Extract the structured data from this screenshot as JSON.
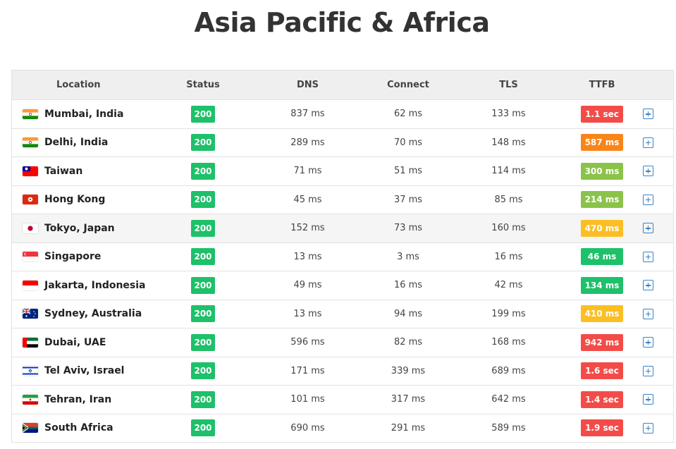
{
  "page": {
    "title": "Asia Pacific & Africa"
  },
  "table": {
    "headers": {
      "location": "Location",
      "status": "Status",
      "dns": "DNS",
      "connect": "Connect",
      "tls": "TLS",
      "ttfb": "TTFB"
    },
    "rows": [
      {
        "flag": "india-flag-icon",
        "location": "Mumbai, India",
        "status": "200",
        "dns": "837 ms",
        "connect": "62 ms",
        "tls": "133 ms",
        "ttfb": "1.1 sec",
        "ttfb_color": "#f34c48"
      },
      {
        "flag": "india-flag-icon",
        "location": "Delhi, India",
        "status": "200",
        "dns": "289 ms",
        "connect": "70 ms",
        "tls": "148 ms",
        "ttfb": "587 ms",
        "ttfb_color": "#f98519"
      },
      {
        "flag": "taiwan-flag-icon",
        "location": "Taiwan",
        "status": "200",
        "dns": "71 ms",
        "connect": "51 ms",
        "tls": "114 ms",
        "ttfb": "300 ms",
        "ttfb_color": "#8bc34a"
      },
      {
        "flag": "hong-kong-flag-icon",
        "location": "Hong Kong",
        "status": "200",
        "dns": "45 ms",
        "connect": "37 ms",
        "tls": "85 ms",
        "ttfb": "214 ms",
        "ttfb_color": "#8bc34a"
      },
      {
        "flag": "japan-flag-icon",
        "location": "Tokyo, Japan",
        "status": "200",
        "dns": "152 ms",
        "connect": "73 ms",
        "tls": "160 ms",
        "ttfb": "470 ms",
        "ttfb_color": "#fbbf24",
        "highlight": true
      },
      {
        "flag": "singapore-flag-icon",
        "location": "Singapore",
        "status": "200",
        "dns": "13 ms",
        "connect": "3 ms",
        "tls": "16 ms",
        "ttfb": "46 ms",
        "ttfb_color": "#1ec06a"
      },
      {
        "flag": "indonesia-flag-icon",
        "location": "Jakarta, Indonesia",
        "status": "200",
        "dns": "49 ms",
        "connect": "16 ms",
        "tls": "42 ms",
        "ttfb": "134 ms",
        "ttfb_color": "#1ec06a"
      },
      {
        "flag": "australia-flag-icon",
        "location": "Sydney, Australia",
        "status": "200",
        "dns": "13 ms",
        "connect": "94 ms",
        "tls": "199 ms",
        "ttfb": "410 ms",
        "ttfb_color": "#fbbf24"
      },
      {
        "flag": "uae-flag-icon",
        "location": "Dubai, UAE",
        "status": "200",
        "dns": "596 ms",
        "connect": "82 ms",
        "tls": "168 ms",
        "ttfb": "942 ms",
        "ttfb_color": "#f34c48"
      },
      {
        "flag": "israel-flag-icon",
        "location": "Tel Aviv, Israel",
        "status": "200",
        "dns": "171 ms",
        "connect": "339 ms",
        "tls": "689 ms",
        "ttfb": "1.6 sec",
        "ttfb_color": "#f34c48"
      },
      {
        "flag": "iran-flag-icon",
        "location": "Tehran, Iran",
        "status": "200",
        "dns": "101 ms",
        "connect": "317 ms",
        "tls": "642 ms",
        "ttfb": "1.4 sec",
        "ttfb_color": "#f34c48"
      },
      {
        "flag": "south-africa-flag-icon",
        "location": "South Africa",
        "status": "200",
        "dns": "690 ms",
        "connect": "291 ms",
        "tls": "589 ms",
        "ttfb": "1.9 sec",
        "ttfb_color": "#f34c48"
      }
    ]
  },
  "colors": {
    "status_ok": "#1ec06a",
    "expand_icon": "#3b82c4",
    "header_bg": "#efefef"
  }
}
